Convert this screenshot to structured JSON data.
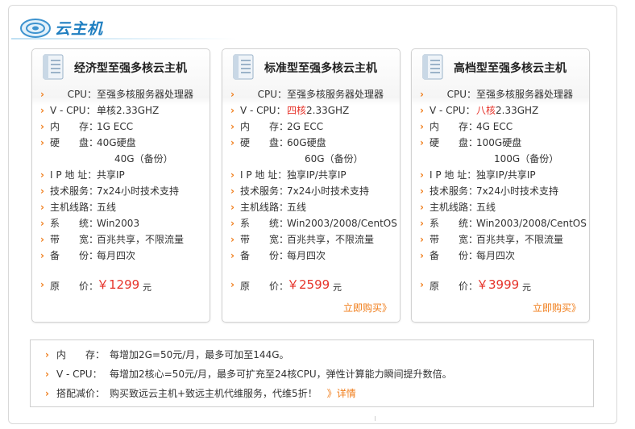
{
  "header": {
    "title": "云主机",
    "colors": {
      "brand": "#1f7fc1",
      "accent": "#f07d1a",
      "highlight": "#e6332a"
    }
  },
  "cards": [
    {
      "title": "经济型至强多核云主机",
      "icon": "document-icon",
      "specs": [
        {
          "label": "CPU：",
          "value": "至强多核服务器处理器"
        },
        {
          "label": "V - CPU：",
          "value": "单核2.33GHZ"
        },
        {
          "label": "内　　存：",
          "value": "1G ECC"
        },
        {
          "label": "硬　　盘：",
          "value": "40G硬盘"
        },
        {
          "label": "",
          "value": "40G（备份）",
          "continuation": true
        },
        {
          "label": "I P 地 址：",
          "value": "共享IP"
        },
        {
          "label": "技术服务：",
          "value": "7x24小时技术支持"
        },
        {
          "label": "主机线路：",
          "value": "五线"
        },
        {
          "label": "系　　统：",
          "value": "Win2003"
        },
        {
          "label": "带　　宽：",
          "value": "百兆共享，不限流量"
        },
        {
          "label": "备　　份：",
          "value": "每月四次"
        }
      ],
      "price_label": "原　　价：",
      "price": "￥1299",
      "price_unit": "元",
      "buy_label": ""
    },
    {
      "title": "标准型至强多核云主机",
      "icon": "document-icon",
      "specs": [
        {
          "label": "CPU：",
          "value": "至强多核服务器处理器"
        },
        {
          "label": "V - CPU：",
          "value_red": "四核",
          "value": "2.33GHZ"
        },
        {
          "label": "内　　存：",
          "value": "2G ECC"
        },
        {
          "label": "硬　　盘：",
          "value": "60G硬盘"
        },
        {
          "label": "",
          "value": "60G（备份）",
          "continuation": true
        },
        {
          "label": "I P 地 址：",
          "value": "独享IP/共享IP"
        },
        {
          "label": "技术服务：",
          "value": "7x24小时技术支持"
        },
        {
          "label": "主机线路：",
          "value": "五线"
        },
        {
          "label": "系　　统：",
          "value": "Win2003/2008/CentOS"
        },
        {
          "label": "带　　宽：",
          "value": "百兆共享，不限流量"
        },
        {
          "label": "备　　份：",
          "value": "每月四次"
        }
      ],
      "price_label": "原　　价：",
      "price": "￥2599",
      "price_unit": "元",
      "buy_label": "立即购买》"
    },
    {
      "title": "高档型至强多核云主机",
      "icon": "document-icon",
      "specs": [
        {
          "label": "CPU：",
          "value": "至强多核服务器处理器"
        },
        {
          "label": "V - CPU：",
          "value_red": "八核",
          "value": "2.33GHZ"
        },
        {
          "label": "内　　存：",
          "value": "4G ECC"
        },
        {
          "label": "硬　　盘：",
          "value": "100G硬盘"
        },
        {
          "label": "",
          "value": "100G（备份）",
          "continuation": true
        },
        {
          "label": "I P 地 址：",
          "value": "独享IP/共享IP"
        },
        {
          "label": "技术服务：",
          "value": "7x24小时技术支持"
        },
        {
          "label": "主机线路：",
          "value": "五线"
        },
        {
          "label": "系　　统：",
          "value": "Win2003/2008/CentOS"
        },
        {
          "label": "带　　宽：",
          "value": "百兆共享，不限流量"
        },
        {
          "label": "备　　份：",
          "value": "每月四次"
        }
      ],
      "price_label": "原　　价：",
      "price": "￥3999",
      "price_unit": "元",
      "buy_label": "立即购买》"
    }
  ],
  "notes": [
    {
      "label": "内　　存：",
      "text": "每增加2G=50元/月，最多可加至144G。"
    },
    {
      "label": "V - CPU：",
      "text": "每增加2核心=50元/月，最多可扩充至24核CPU，弹性计算能力瞬间提升数倍。"
    },
    {
      "label": "搭配减价：",
      "text": "购买致远云主机+致远主机代维服务，代维5折！",
      "more": "》详情"
    }
  ]
}
